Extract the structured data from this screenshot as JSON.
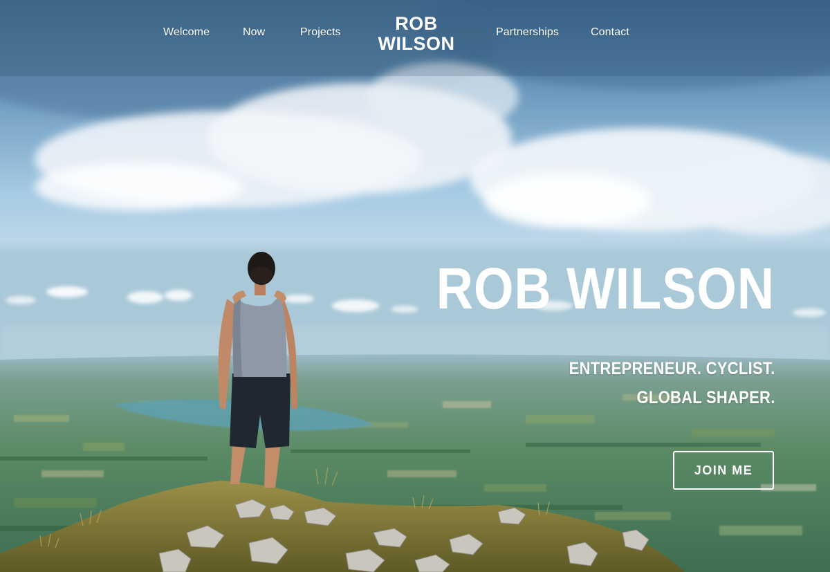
{
  "nav": {
    "items": [
      {
        "label": "Welcome"
      },
      {
        "label": "Now"
      },
      {
        "label": "Projects"
      },
      {
        "label": "Partnerships"
      },
      {
        "label": "Contact"
      }
    ],
    "logo_line1": "ROB",
    "logo_line2": "WILSON"
  },
  "hero": {
    "title": "ROB WILSON",
    "tagline_line1": "ENTREPRENEUR. CYCLIST.",
    "tagline_line2": "GLOBAL SHAPER.",
    "cta_label": "JOIN ME",
    "image": "man standing on mountain summit overlooking valley and lake"
  },
  "colors": {
    "text": "#ffffff",
    "sky_top": "#3f6d94",
    "sky_mid": "#a6cbe4",
    "valley": "#4f7f68",
    "grass": "#7f7a35"
  }
}
